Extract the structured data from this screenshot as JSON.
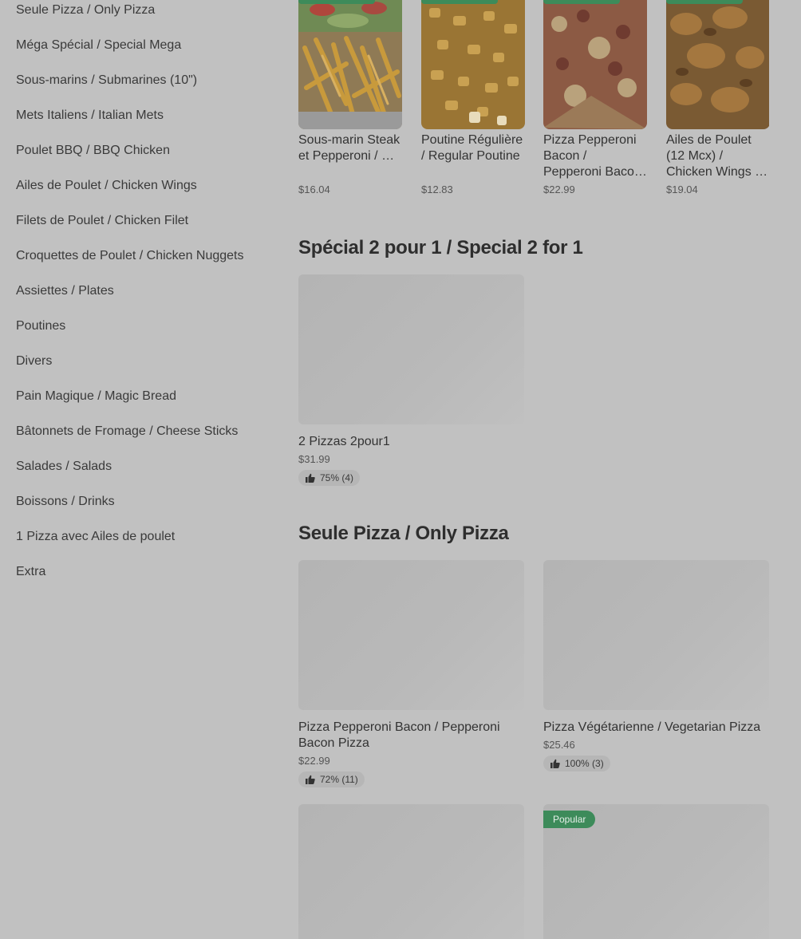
{
  "sidebar": {
    "items": [
      {
        "label": "Seule Pizza / Only Pizza"
      },
      {
        "label": "Méga Spécial / Special Mega"
      },
      {
        "label": "Sous-marins / Submarines (10\")"
      },
      {
        "label": "Mets Italiens / Italian Mets"
      },
      {
        "label": "Poulet BBQ / BBQ Chicken"
      },
      {
        "label": "Ailes de Poulet / Chicken Wings"
      },
      {
        "label": "Filets de Poulet / Chicken Filet"
      },
      {
        "label": "Croquettes de Poulet / Chicken Nuggets"
      },
      {
        "label": "Assiettes / Plates"
      },
      {
        "label": "Poutines"
      },
      {
        "label": "Divers"
      },
      {
        "label": "Pain Magique / Magic Bread"
      },
      {
        "label": "Bâtonnets de Fromage / Cheese Sticks"
      },
      {
        "label": "Salades / Salads"
      },
      {
        "label": "Boissons / Drinks"
      },
      {
        "label": "1 Pizza avec Ailes de poulet"
      },
      {
        "label": "Extra"
      }
    ]
  },
  "popular": {
    "items": [
      {
        "title": "Sous-marin Steak et Pepperoni / …",
        "price": "$16.04",
        "image": "sub-fries-photo"
      },
      {
        "title": "Poutine Régulière / Regular Poutine",
        "price": "$12.83",
        "image": "poutine-photo"
      },
      {
        "title": "Pizza Pepperoni Bacon / Pepperoni Baco…",
        "price": "$22.99",
        "image": "pizza-photo"
      },
      {
        "title": "Ailes de Poulet (12 Mcx) / Chicken Wings …",
        "price": "$19.04",
        "image": "wings-photo"
      }
    ]
  },
  "sections": {
    "special": {
      "title": "Spécial 2 pour 1 / Special 2 for 1",
      "items": [
        {
          "title": "2 Pizzas 2pour1",
          "price": "$31.99",
          "rating": "75% (4)"
        }
      ]
    },
    "only_pizza": {
      "title": "Seule Pizza / Only Pizza",
      "items": [
        {
          "title": "Pizza Pepperoni Bacon / Pepperoni Bacon Pizza",
          "price": "$22.99",
          "rating": "72% (11)"
        },
        {
          "title": "Pizza Végétarienne / Vegetarian Pizza",
          "price": "$25.46",
          "rating": "100% (3)"
        },
        {
          "badge": ""
        },
        {
          "badge": "Popular"
        }
      ]
    }
  },
  "colors": {
    "background": "#c1c1c1",
    "accent_green": "#3d8b5a",
    "placeholder": "#b6b6b6"
  }
}
